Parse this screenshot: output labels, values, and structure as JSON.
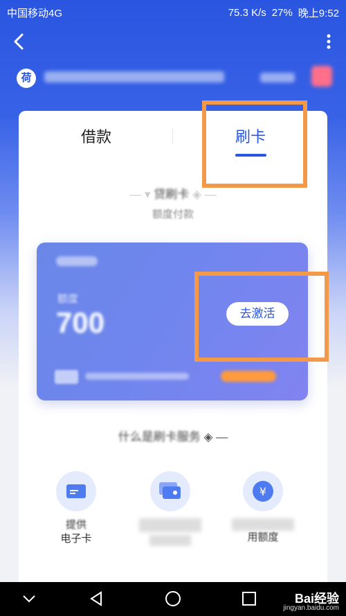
{
  "status_bar": {
    "carrier": "中国移动4G",
    "speed": "75.3 K/s",
    "battery": "27%",
    "time": "晚上9:52"
  },
  "header": {
    "back_icon": "back-arrow-icon",
    "more_icon": "more-vertical-icon",
    "logo_char": "荷"
  },
  "tabs": [
    {
      "label": "借款",
      "active": false
    },
    {
      "label": "刷卡",
      "active": true
    }
  ],
  "section1": {
    "title": "贷刷卡",
    "subtitle": "额度付款"
  },
  "credit_card": {
    "amount_label": "额度",
    "amount": "700",
    "activate_label": "去激活"
  },
  "section2": {
    "title": "什么是刷卡服务"
  },
  "features": [
    {
      "icon": "card-icon",
      "label_line1": "提供",
      "label_line2": "电子卡"
    },
    {
      "icon": "card-stack-icon",
      "label_line1": "",
      "label_line2": ""
    },
    {
      "icon": "yen-icon",
      "label_line1": "",
      "label_line2": "用额度"
    }
  ],
  "colors": {
    "accent": "#2a55e0",
    "highlight": "#f39a4a"
  },
  "watermark": {
    "brand": "Bai经验",
    "url": "jingyan.baidu.com"
  }
}
